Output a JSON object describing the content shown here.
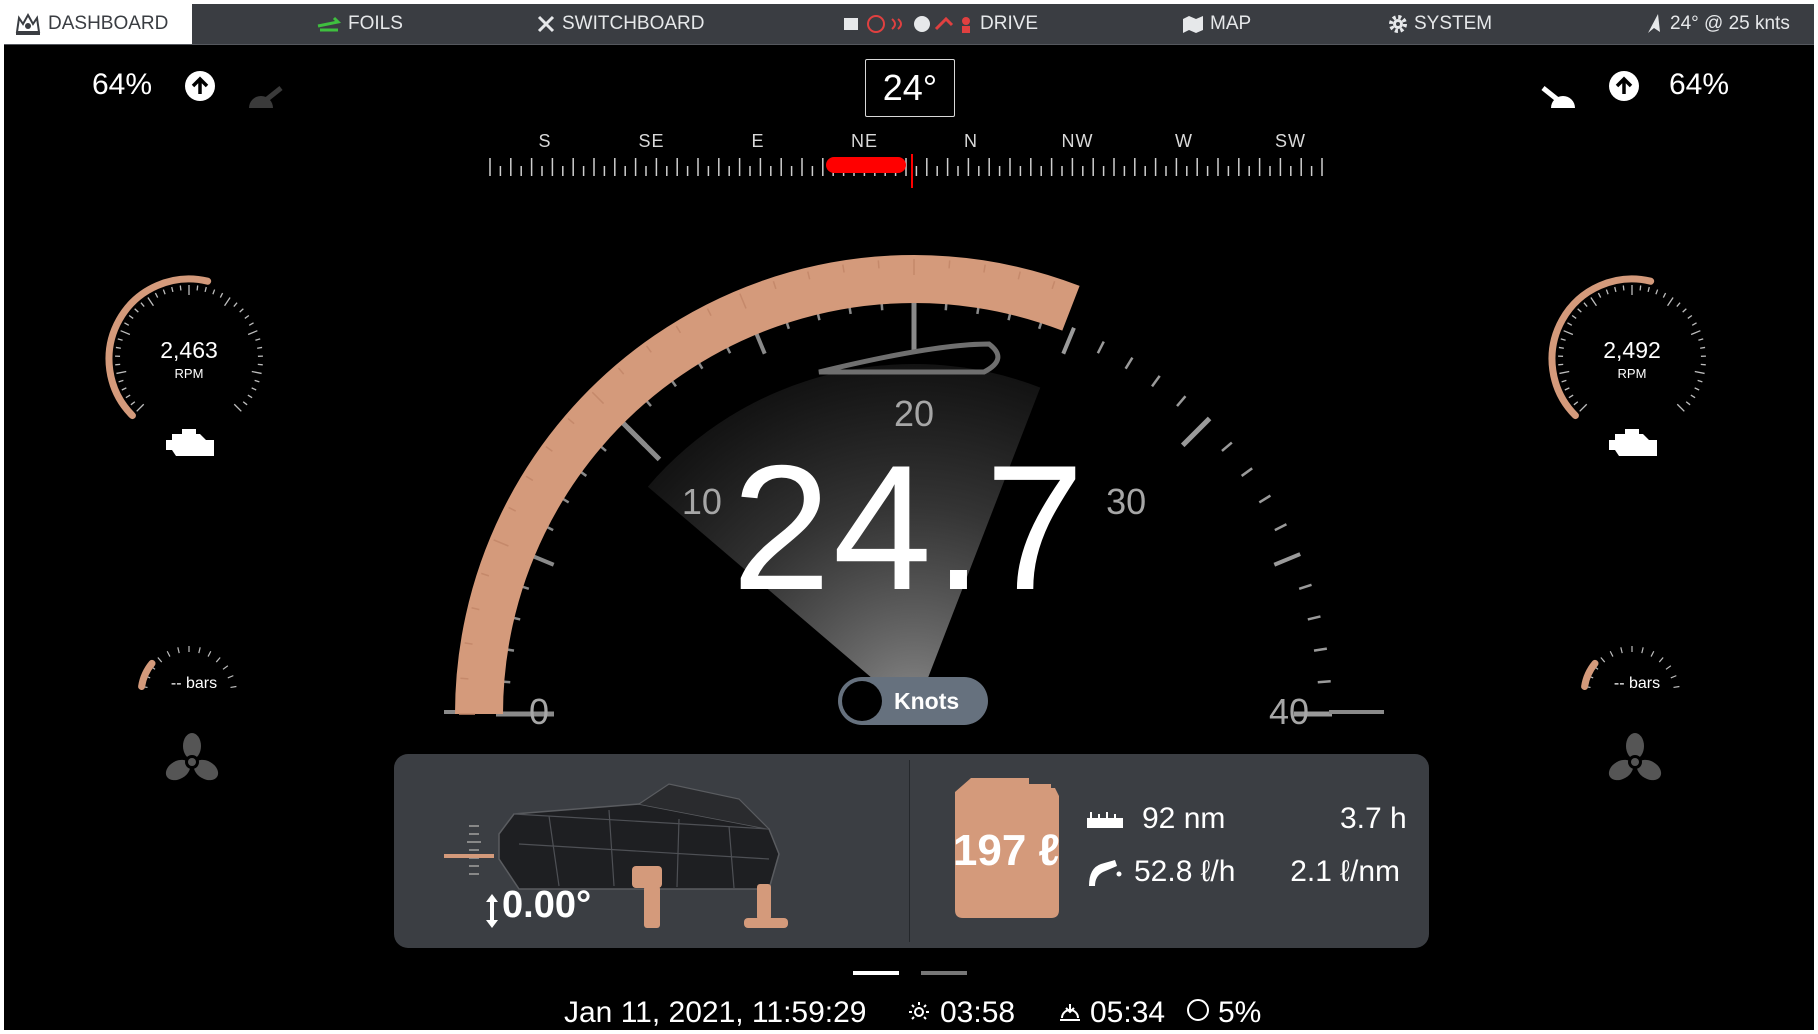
{
  "nav": {
    "dashboard": "DASHBOARD",
    "foils": "FOILS",
    "switchboard": "SWITCHBOARD",
    "drive": "DRIVE",
    "map": "MAP",
    "system": "SYSTEM",
    "wind": "24° @ 25 knts"
  },
  "left_engine": {
    "throttle_pct": "64%",
    "rpm": "2,463",
    "rpm_label": "RPM",
    "rpm_fill_fraction": 0.55,
    "pressure": "-- bars"
  },
  "right_engine": {
    "throttle_pct": "64%",
    "rpm": "2,492",
    "rpm_label": "RPM",
    "rpm_fill_fraction": 0.55,
    "pressure": "-- bars"
  },
  "compass": {
    "heading": "24°",
    "labels": [
      "S",
      "SE",
      "E",
      "NE",
      "N",
      "NW",
      "W",
      "SW"
    ]
  },
  "speed": {
    "value": "24.7",
    "min": 0,
    "max": 40,
    "scale_labels": [
      "0",
      "10",
      "20",
      "30",
      "40"
    ],
    "fill_value": 24.7,
    "units": "Knots"
  },
  "trim": {
    "pitch": "0.00°"
  },
  "fuel": {
    "volume": "197 ℓ",
    "range": "92 nm",
    "time": "3.7 h",
    "rate": "52.8 ℓ/h",
    "economy": "2.1 ℓ/nm"
  },
  "footer": {
    "datetime": "Jan 11, 2021, 11:59:29",
    "sunrise": "03:58",
    "sunset": "05:34",
    "moon": "5%"
  },
  "colors": {
    "accent": "#d49a7b",
    "nav_bg": "#3a3d42",
    "panel_bg": "#3b3e43",
    "toggle_bg": "#66717e",
    "compass_red": "#ff0000",
    "foils_green": "#3fbf3f",
    "drive_red": "#e04040"
  },
  "icons": {
    "dashboard": "crown-icon",
    "foils": "foils-icon",
    "switchboard": "tools-icon",
    "map": "map-icon",
    "system": "gear-icon",
    "wind": "navigation-arrow-icon",
    "engine": "engine-icon",
    "propeller": "propeller-icon",
    "throttle": "arrow-up-circle-icon",
    "range": "ruler-icon",
    "fuel_rate": "fuel-nozzle-icon",
    "sunrise": "sun-icon",
    "sunset": "sunset-icon",
    "moon": "moon-icon"
  }
}
